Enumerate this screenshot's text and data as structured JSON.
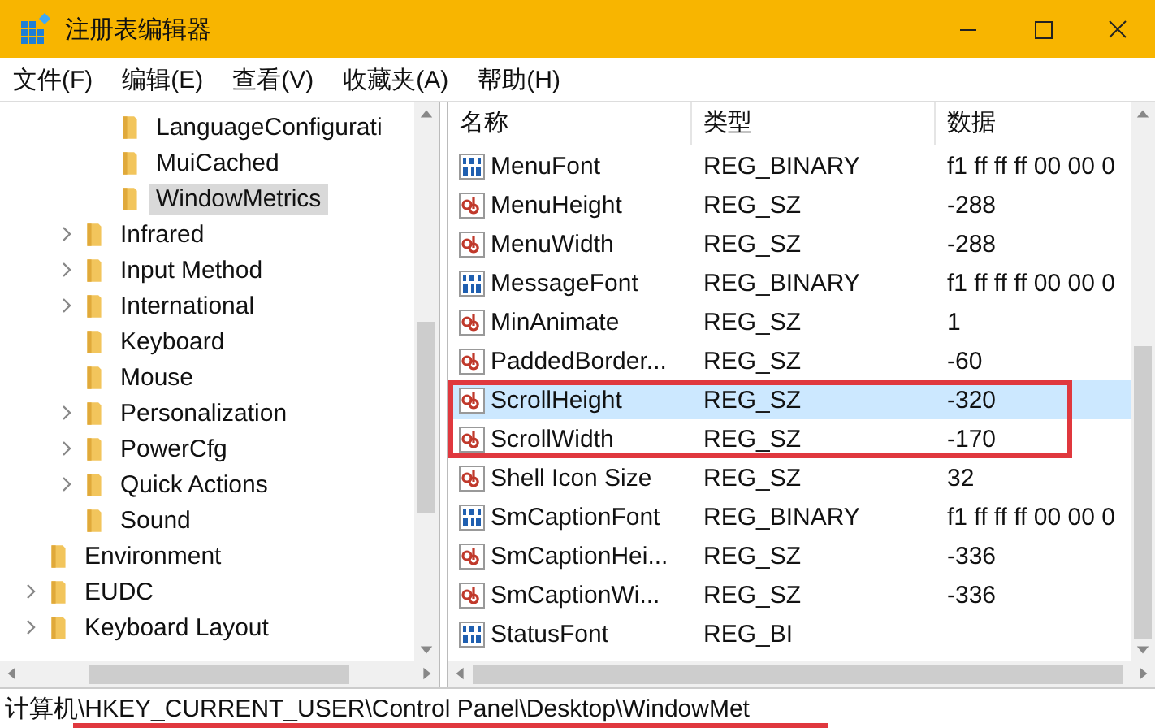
{
  "window": {
    "title": "注册表编辑器"
  },
  "menu": [
    "文件(F)",
    "编辑(E)",
    "查看(V)",
    "收藏夹(A)",
    "帮助(H)"
  ],
  "tree": {
    "items": [
      {
        "children": [
          {
            "children": [
              {
                "label": "LanguageConfigurati",
                "expandable": false,
                "selected": false
              },
              {
                "label": "MuiCached",
                "expandable": false,
                "selected": false
              },
              {
                "label": "WindowMetrics",
                "expandable": false,
                "selected": true
              }
            ]
          },
          {
            "label": "Infrared",
            "expandable": true,
            "selected": false
          },
          {
            "label": "Input Method",
            "expandable": true,
            "selected": false
          },
          {
            "label": "International",
            "expandable": true,
            "selected": false
          },
          {
            "label": "Keyboard",
            "expandable": false,
            "selected": false
          },
          {
            "label": "Mouse",
            "expandable": false,
            "selected": false
          },
          {
            "label": "Personalization",
            "expandable": true,
            "selected": false
          },
          {
            "label": "PowerCfg",
            "expandable": true,
            "selected": false
          },
          {
            "label": "Quick Actions",
            "expandable": true,
            "selected": false
          },
          {
            "label": "Sound",
            "expandable": false,
            "selected": false
          }
        ]
      },
      {
        "label": "Environment",
        "expandable": false,
        "selected": false
      },
      {
        "label": "EUDC",
        "expandable": true,
        "selected": false
      },
      {
        "label": "Keyboard Layout",
        "expandable": true,
        "selected": false
      }
    ]
  },
  "table": {
    "columns": [
      "名称",
      "类型",
      "数据"
    ],
    "rows": [
      {
        "kind": "binary",
        "name": "MenuFont",
        "type": "REG_BINARY",
        "data": "f1 ff ff ff 00 00 0",
        "selected": false,
        "highlighted": false
      },
      {
        "kind": "string",
        "name": "MenuHeight",
        "type": "REG_SZ",
        "data": "-288",
        "selected": false,
        "highlighted": false
      },
      {
        "kind": "string",
        "name": "MenuWidth",
        "type": "REG_SZ",
        "data": "-288",
        "selected": false,
        "highlighted": false
      },
      {
        "kind": "binary",
        "name": "MessageFont",
        "type": "REG_BINARY",
        "data": "f1 ff ff ff 00 00 0",
        "selected": false,
        "highlighted": false
      },
      {
        "kind": "string",
        "name": "MinAnimate",
        "type": "REG_SZ",
        "data": "1",
        "selected": false,
        "highlighted": false
      },
      {
        "kind": "string",
        "name": "PaddedBorder...",
        "type": "REG_SZ",
        "data": "-60",
        "selected": false,
        "highlighted": false
      },
      {
        "kind": "string",
        "name": "ScrollHeight",
        "type": "REG_SZ",
        "data": "-320",
        "selected": true,
        "highlighted": true
      },
      {
        "kind": "string",
        "name": "ScrollWidth",
        "type": "REG_SZ",
        "data": "-170",
        "selected": false,
        "highlighted": true
      },
      {
        "kind": "string",
        "name": "Shell Icon Size",
        "type": "REG_SZ",
        "data": "32",
        "selected": false,
        "highlighted": false
      },
      {
        "kind": "binary",
        "name": "SmCaptionFont",
        "type": "REG_BINARY",
        "data": "f1 ff ff ff 00 00 0",
        "selected": false,
        "highlighted": false
      },
      {
        "kind": "string",
        "name": "SmCaptionHei...",
        "type": "REG_SZ",
        "data": "-336",
        "selected": false,
        "highlighted": false
      },
      {
        "kind": "string",
        "name": "SmCaptionWi...",
        "type": "REG_SZ",
        "data": "-336",
        "selected": false,
        "highlighted": false
      },
      {
        "kind": "binary",
        "name": "StatusFont",
        "type": "REG_BI",
        "selected": false,
        "highlighted": false
      }
    ]
  },
  "status_bar": {
    "path": "计算机\\HKEY_CURRENT_USER\\Control Panel\\Desktop\\WindowMet",
    "underlined": true
  }
}
